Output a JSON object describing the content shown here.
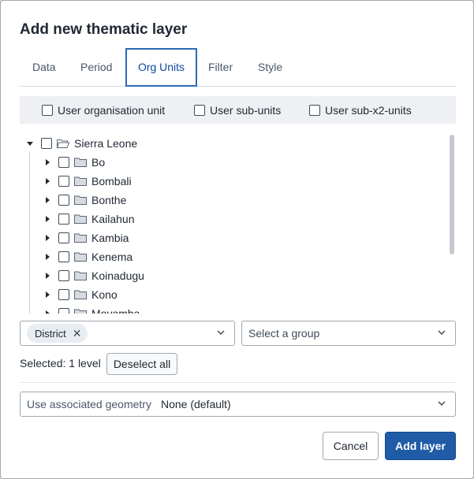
{
  "dialog": {
    "title": "Add new thematic layer"
  },
  "tabs": [
    {
      "label": "Data"
    },
    {
      "label": "Period"
    },
    {
      "label": "Org Units",
      "active": true
    },
    {
      "label": "Filter"
    },
    {
      "label": "Style"
    }
  ],
  "ou_options": [
    {
      "label": "User organisation unit",
      "checked": false
    },
    {
      "label": "User sub-units",
      "checked": false
    },
    {
      "label": "User sub-x2-units",
      "checked": false
    }
  ],
  "tree": {
    "root": {
      "label": "Sierra Leone",
      "expanded": true,
      "checked": false,
      "icon": "folder-open-icon"
    },
    "children": [
      {
        "label": "Bo",
        "checked": false,
        "icon": "folder-icon"
      },
      {
        "label": "Bombali",
        "checked": false,
        "icon": "folder-icon"
      },
      {
        "label": "Bonthe",
        "checked": false,
        "icon": "folder-icon"
      },
      {
        "label": "Kailahun",
        "checked": false,
        "icon": "folder-icon"
      },
      {
        "label": "Kambia",
        "checked": false,
        "icon": "folder-icon"
      },
      {
        "label": "Kenema",
        "checked": false,
        "icon": "folder-icon"
      },
      {
        "label": "Koinadugu",
        "checked": false,
        "icon": "folder-icon"
      },
      {
        "label": "Kono",
        "checked": false,
        "icon": "folder-icon"
      },
      {
        "label": "Moyamba",
        "checked": false,
        "icon": "folder-icon"
      }
    ]
  },
  "level_select": {
    "chip": "District"
  },
  "group_select": {
    "placeholder": "Select a group"
  },
  "selection": {
    "summary": "Selected: 1 level",
    "deselect_label": "Deselect all"
  },
  "geometry": {
    "label": "Use associated geometry",
    "value": "None (default)"
  },
  "footer": {
    "cancel_label": "Cancel",
    "add_label": "Add layer"
  },
  "colors": {
    "accent": "#2d6bb5",
    "primary_button": "#1f5ba6",
    "bar_bg": "#eef0f3"
  }
}
